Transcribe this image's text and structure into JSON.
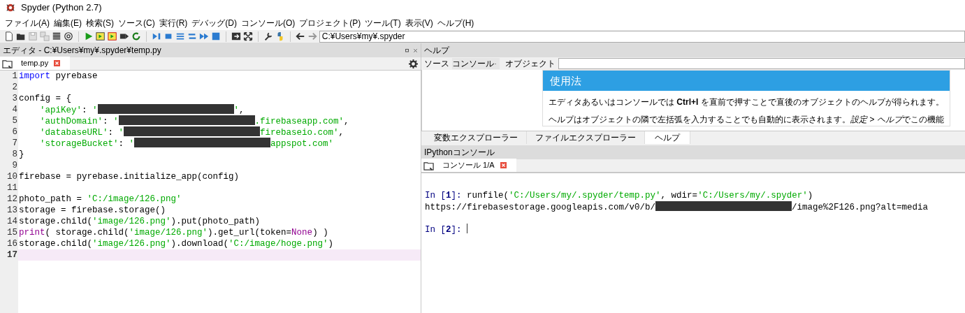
{
  "window": {
    "title": "Spyder (Python 2.7)"
  },
  "menu": [
    "ファイル(A)",
    "編集(E)",
    "検索(S)",
    "ソース(C)",
    "実行(R)",
    "デバッグ(D)",
    "コンソール(O)",
    "プロジェクト(P)",
    "ツール(T)",
    "表示(V)",
    "ヘルプ(H)"
  ],
  "toolbar": {
    "path": "C:¥Users¥my¥.spyder"
  },
  "editor": {
    "title": "エディタ - C:¥Users¥my¥.spyder¥temp.py",
    "tabs": [
      {
        "label": "temp.py",
        "selected": true
      }
    ],
    "lines": [
      {
        "number": "1",
        "current": false,
        "tokens": [
          {
            "kind": "kw",
            "text": "import"
          },
          {
            "kind": "plain",
            "text": " pyrebase"
          }
        ]
      },
      {
        "number": "2",
        "current": false
      },
      {
        "number": "3",
        "current": false,
        "tokens": [
          {
            "kind": "plain",
            "text": "config = {"
          }
        ]
      },
      {
        "number": "4",
        "current": false,
        "tokens": [
          {
            "kind": "str",
            "text": "    'apiKey'"
          },
          {
            "kind": "plain",
            "text": ": "
          },
          {
            "kind": "str",
            "text": "'"
          },
          {
            "kind": "redacted"
          },
          {
            "kind": "str",
            "text": "'"
          },
          {
            "kind": "plain",
            "text": ","
          }
        ]
      },
      {
        "number": "5",
        "current": false,
        "tokens": [
          {
            "kind": "str",
            "text": "    'authDomain'"
          },
          {
            "kind": "plain",
            "text": ": "
          },
          {
            "kind": "str",
            "text": "'"
          },
          {
            "kind": "redacted"
          },
          {
            "kind": "str",
            "text": ".firebaseapp.com'"
          },
          {
            "kind": "plain",
            "text": ","
          }
        ]
      },
      {
        "number": "6",
        "current": false,
        "tokens": [
          {
            "kind": "str",
            "text": "    'databaseURL'"
          },
          {
            "kind": "plain",
            "text": ": "
          },
          {
            "kind": "str",
            "text": "'"
          },
          {
            "kind": "redacted"
          },
          {
            "kind": "str",
            "text": "firebaseio.com'"
          },
          {
            "kind": "plain",
            "text": ","
          }
        ]
      },
      {
        "number": "7",
        "current": false,
        "tokens": [
          {
            "kind": "str",
            "text": "    'storageBucket'"
          },
          {
            "kind": "plain",
            "text": ": "
          },
          {
            "kind": "str",
            "text": "'"
          },
          {
            "kind": "redacted"
          },
          {
            "kind": "str",
            "text": "appspot.com'"
          }
        ]
      },
      {
        "number": "8",
        "current": false,
        "tokens": [
          {
            "kind": "plain",
            "text": "}"
          }
        ]
      },
      {
        "number": "9",
        "current": false
      },
      {
        "number": "10",
        "current": false,
        "tokens": [
          {
            "kind": "plain",
            "text": "firebase = pyrebase.initialize_app(config)"
          }
        ]
      },
      {
        "number": "11",
        "current": false
      },
      {
        "number": "12",
        "current": false,
        "tokens": [
          {
            "kind": "plain",
            "text": "photo_path = "
          },
          {
            "kind": "str",
            "text": "'C:/image/126.png'"
          }
        ]
      },
      {
        "number": "13",
        "current": false,
        "tokens": [
          {
            "kind": "plain",
            "text": "storage = firebase.storage()"
          }
        ]
      },
      {
        "number": "14",
        "current": false,
        "tokens": [
          {
            "kind": "plain",
            "text": "storage.child("
          },
          {
            "kind": "str",
            "text": "'image/126.png'"
          },
          {
            "kind": "plain",
            "text": ").put(photo_path)"
          }
        ]
      },
      {
        "number": "15",
        "current": false,
        "tokens": [
          {
            "kind": "builtin",
            "text": "print"
          },
          {
            "kind": "plain",
            "text": "( storage.child("
          },
          {
            "kind": "str",
            "text": "'image/126.png'"
          },
          {
            "kind": "plain",
            "text": ").get_url(token="
          },
          {
            "kind": "builtin",
            "text": "None"
          },
          {
            "kind": "plain",
            "text": ") )"
          }
        ]
      },
      {
        "number": "16",
        "current": false,
        "tokens": [
          {
            "kind": "plain",
            "text": "storage.child("
          },
          {
            "kind": "str",
            "text": "'image/126.png'"
          },
          {
            "kind": "plain",
            "text": ").download("
          },
          {
            "kind": "str",
            "text": "'C:/image/hoge.png'"
          },
          {
            "kind": "plain",
            "text": ")"
          }
        ]
      },
      {
        "number": "17",
        "current": true
      }
    ]
  },
  "help": {
    "title": "ヘルプ",
    "source_label": "ソース",
    "source_value": "コンソール",
    "object_label": "オブジェクト",
    "card_title": "使用法",
    "paragraphs": [
      [
        {
          "kind": "plain",
          "text": "エディタあるいはコンソールでは "
        },
        {
          "kind": "shortcut",
          "text": "Ctrl+I"
        },
        {
          "kind": "plain",
          "text": " を直前で押すことで直後のオブジェクトのヘルプが得られます。"
        }
      ],
      [
        {
          "kind": "plain",
          "text": "ヘルプはオブジェクトの隣で左括弧を入力することでも自動的に表示されます。"
        },
        {
          "kind": "menu_path",
          "text": "設定 > ヘルプ"
        },
        {
          "kind": "plain",
          "text": "でこの機能"
        }
      ]
    ]
  },
  "bottom_tabs": [
    {
      "label": "変数エクスプローラー",
      "selected": false
    },
    {
      "label": "ファイルエクスプローラー",
      "selected": false
    },
    {
      "label": "ヘルプ",
      "selected": true
    }
  ],
  "console": {
    "title": "IPythonコンソール",
    "tabs": [
      {
        "label": "コンソール 1/A",
        "selected": true
      }
    ],
    "lines": [
      {
        "tokens": [
          {
            "kind": "prompt",
            "text": "In ["
          },
          {
            "kind": "prompt_num",
            "text": "1"
          },
          {
            "kind": "prompt",
            "text": "]: "
          },
          {
            "kind": "plain",
            "text": "runfile("
          },
          {
            "kind": "str",
            "text": "'C:/Users/my/.spyder/temp.py'"
          },
          {
            "kind": "plain",
            "text": ", wdir="
          },
          {
            "kind": "str",
            "text": "'C:/Users/my/.spyder'"
          },
          {
            "kind": "plain",
            "text": ")"
          }
        ]
      },
      {
        "tokens": [
          {
            "kind": "plain",
            "text": "https://firebasestorage.googleapis.com/v0/b/"
          },
          {
            "kind": "redacted"
          },
          {
            "kind": "plain",
            "text": "/image%2F126.png?alt=media"
          }
        ]
      },
      {
        "tokens": [
          {
            "kind": "prompt",
            "text": "In ["
          },
          {
            "kind": "prompt_num",
            "text": "2"
          },
          {
            "kind": "prompt",
            "text": "]: "
          },
          {
            "kind": "cursor"
          }
        ]
      }
    ]
  }
}
